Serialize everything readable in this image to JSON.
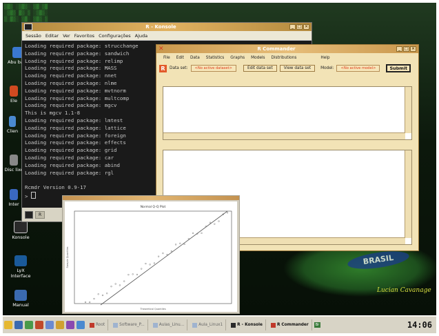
{
  "konsole": {
    "title": "R - Konsole",
    "menu": [
      "Sessão",
      "Editar",
      "Ver",
      "Favoritos",
      "Configurações",
      "Ajuda"
    ],
    "lines": [
      "Loading required package: strucchange",
      "Loading required package: sandwich",
      "Loading required package: relimp",
      "Loading required package: MASS",
      "Loading required package: nnet",
      "Loading required package: nlme",
      "Loading required package: mvtnorm",
      "Loading required package: multcomp",
      "Loading required package: mgcv",
      "This is mgcv 1.1-8",
      "Loading required package: lmtest",
      "Loading required package: lattice",
      "Loading required package: foreign",
      "Loading required package: effects",
      "Loading required package: grid",
      "Loading required package: car",
      "Loading required package: abind",
      "Loading required package: rgl",
      "",
      "Rcmdr Version 0.9-17"
    ],
    "prompt": "> ",
    "tab_label": "R"
  },
  "rcommander": {
    "title": "R Commander",
    "menu": [
      "File",
      "Edit",
      "Data",
      "Statistics",
      "Graphs",
      "Models",
      "Distributions",
      "Help"
    ],
    "data_set_label": "Data set:",
    "data_set_value": "<No active dataset>",
    "edit_button": "Edit data set",
    "view_button": "View data set",
    "model_label": "Model:",
    "model_value": "<No active model>",
    "submit": "Submit"
  },
  "plot": {
    "title": "Normal Q-Q Plot",
    "xlabel": "Theoretical Quantiles",
    "ylabel": "Sample Quantiles"
  },
  "desktop": {
    "icons": [
      {
        "label": "Abu barra",
        "color": "#3a78d0"
      },
      {
        "label": "Ele",
        "color": "#d04a20"
      },
      {
        "label": "Clien",
        "color": "#4a8ad0"
      },
      {
        "label": "Disc lixe",
        "color": "#888888"
      },
      {
        "label": "Inter",
        "color": "#3a68c0"
      },
      {
        "label": "Konsole",
        "color": "#2a2a2a"
      },
      {
        "label": "LyX Interface",
        "color": "#1a5a9a"
      },
      {
        "label": "Manual",
        "color": "#3a6ab0"
      }
    ],
    "brazil_logo": "BRASIL",
    "signature": "Lucian Cavanage"
  },
  "taskbar": {
    "tasks": [
      {
        "label": "Root",
        "active": false
      },
      {
        "label": "Software_P...",
        "active": false
      },
      {
        "label": "Aulas_Linu...",
        "active": false
      },
      {
        "label": "Aula_Linux1",
        "active": false
      },
      {
        "label": "R - Konsole",
        "active": true
      },
      {
        "label": "R Commander",
        "active": true
      }
    ],
    "keyboard": "Br",
    "clock": "14:06"
  }
}
